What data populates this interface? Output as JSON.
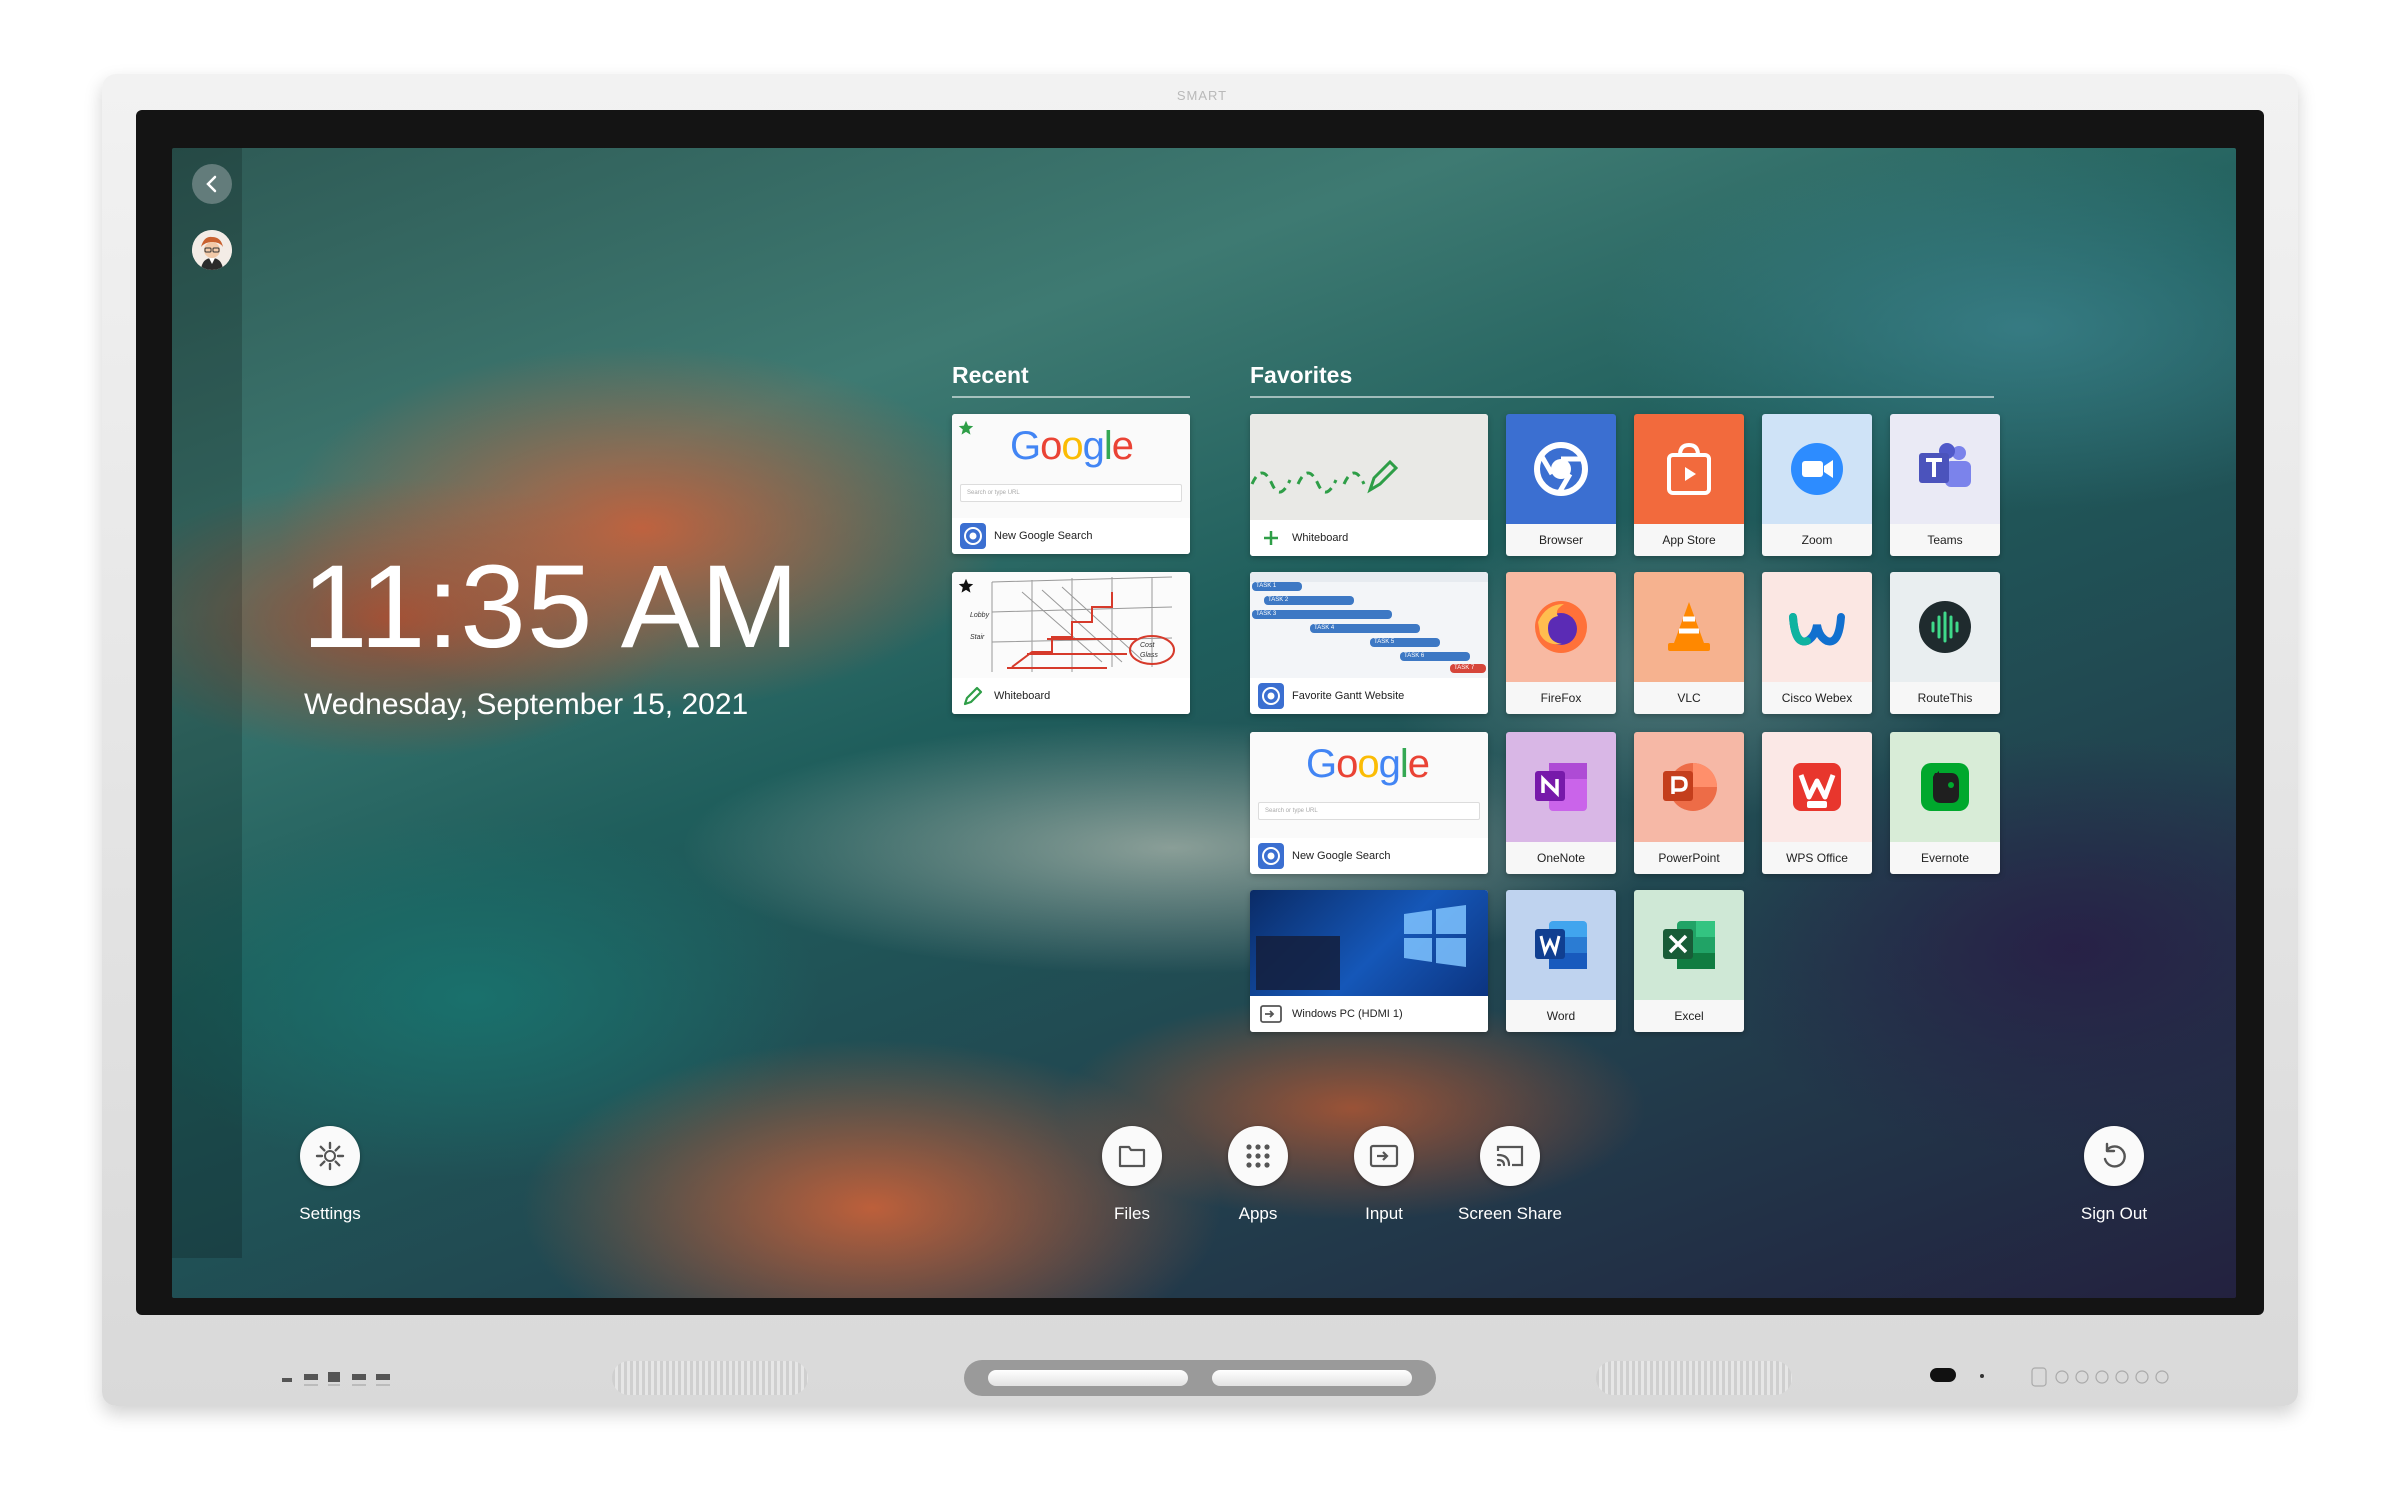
{
  "device": {
    "brand": "SMART"
  },
  "clock": {
    "time": "11:35 AM",
    "date": "Wednesday, September 15, 2021"
  },
  "recent": {
    "title": "Recent",
    "cards": [
      {
        "label": "New Google Search",
        "preview_text": "Google",
        "search_placeholder": "Search or type URL",
        "starred": true,
        "icon": "browser-icon"
      },
      {
        "label": "Whiteboard",
        "starred": true,
        "icon": "pen-icon"
      }
    ]
  },
  "favorites": {
    "title": "Favorites",
    "cards": [
      {
        "label": "Whiteboard",
        "icon": "plus-icon"
      },
      {
        "label": "Favorite Gantt Website",
        "icon": "browser-icon"
      },
      {
        "label": "New Google Search",
        "preview_text": "Google",
        "search_placeholder": "Search or type URL",
        "icon": "browser-icon"
      },
      {
        "label": "Windows PC (HDMI 1)",
        "icon": "input-icon"
      }
    ],
    "apps": [
      {
        "label": "Browser",
        "icon": "browser-icon",
        "color": "#3b6fd1"
      },
      {
        "label": "App Store",
        "icon": "app-store-icon",
        "color": "#f26a3d"
      },
      {
        "label": "Zoom",
        "icon": "zoom-icon",
        "color": "#cfe3f7"
      },
      {
        "label": "Teams",
        "icon": "teams-icon",
        "color": "#eaeaf5"
      },
      {
        "label": "FireFox",
        "icon": "firefox-icon",
        "color": "#f8b9a2"
      },
      {
        "label": "VLC",
        "icon": "vlc-icon",
        "color": "#f6b28f"
      },
      {
        "label": "Cisco Webex",
        "icon": "webex-icon",
        "color": "#fbe7e3"
      },
      {
        "label": "RouteThis",
        "icon": "routethis-icon",
        "color": "#e9eef0"
      },
      {
        "label": "OneNote",
        "icon": "onenote-icon",
        "color": "#d9b7e6"
      },
      {
        "label": "PowerPoint",
        "icon": "powerpoint-icon",
        "color": "#f6b8a6"
      },
      {
        "label": "WPS Office",
        "icon": "wps-office-icon",
        "color": "#fbe8e6"
      },
      {
        "label": "Evernote",
        "icon": "evernote-icon",
        "color": "#d8ecd7"
      },
      {
        "label": "Word",
        "icon": "word-icon",
        "color": "#bfd3ef"
      },
      {
        "label": "Excel",
        "icon": "excel-icon",
        "color": "#cfe8d6"
      }
    ]
  },
  "gantt": {
    "rows": [
      "TASK 1",
      "TASK 2",
      "TASK 3",
      "TASK 4",
      "TASK 5",
      "TASK 6",
      "TASK 7"
    ]
  },
  "whiteboard_preview": {
    "notes": [
      "Lobby",
      "Stair",
      "Cost",
      "Glass"
    ]
  },
  "dock": {
    "settings": "Settings",
    "files": "Files",
    "apps": "Apps",
    "input": "Input",
    "screen_share": "Screen Share",
    "sign_out": "Sign Out"
  },
  "colors": {
    "accent_green": "#2e9e47",
    "google_blue": "#4285F4",
    "google_red": "#EA4335",
    "google_yellow": "#FBBC05",
    "google_green": "#34A853"
  }
}
